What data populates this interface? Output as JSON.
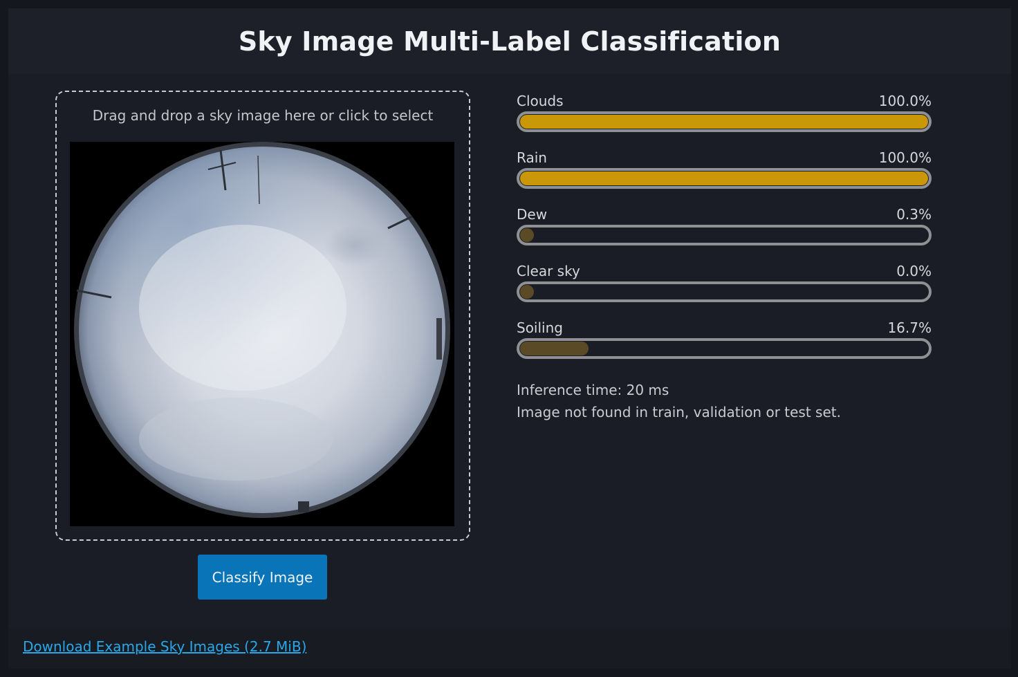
{
  "page": {
    "title": "Sky Image Multi-Label Classification"
  },
  "dropzone": {
    "prompt": "Drag and drop a sky image here or click to select"
  },
  "actions": {
    "classify_label": "Classify Image"
  },
  "colors": {
    "high_fill": "#c99707",
    "low_fill": "#5a4a26",
    "track_border": "#8e9093",
    "button_bg": "#0975b8",
    "link": "#2aa7e8"
  },
  "results": {
    "labels": [
      {
        "name": "Clouds",
        "percent_text": "100.0%",
        "fraction": 1.0,
        "level": "high"
      },
      {
        "name": "Rain",
        "percent_text": "100.0%",
        "fraction": 1.0,
        "level": "high"
      },
      {
        "name": "Dew",
        "percent_text": "0.3%",
        "fraction": 0.003,
        "level": "low"
      },
      {
        "name": "Clear sky",
        "percent_text": "0.0%",
        "fraction": 0.0,
        "level": "low"
      },
      {
        "name": "Soiling",
        "percent_text": "16.7%",
        "fraction": 0.167,
        "level": "low"
      }
    ],
    "inference_time": "Inference time: 20 ms",
    "dataset_note": "Image not found in train, validation or test set."
  },
  "footer": {
    "download_link": "Download Example Sky Images (2.7 MiB)"
  }
}
